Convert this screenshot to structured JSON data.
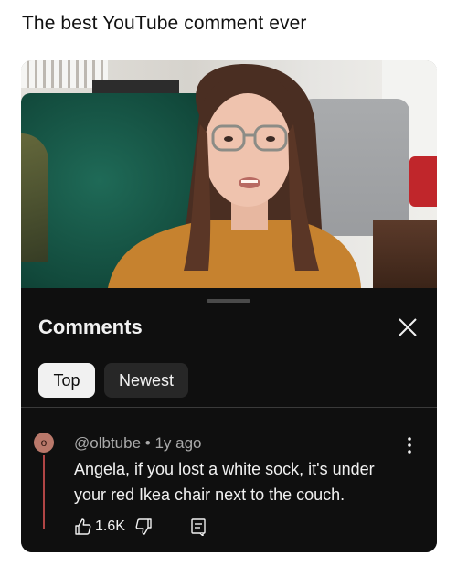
{
  "meme": {
    "title": "The best YouTube comment ever"
  },
  "panel": {
    "heading": "Comments",
    "chips": [
      {
        "label": "Top",
        "selected": true
      },
      {
        "label": "Newest",
        "selected": false
      }
    ]
  },
  "comment": {
    "avatar_letter": "o",
    "author": "@olbtube",
    "separator": "•",
    "time": "1y ago",
    "meta": "@olbtube • 1y ago",
    "text": "Angela, if you lost a white sock, it's under your red Ikea chair next to the couch.",
    "likes": "1.6K"
  },
  "icons": {
    "close": "close-icon",
    "more": "more-vert-icon",
    "like": "thumbs-up-icon",
    "dislike": "thumbs-down-icon",
    "reply": "reply-icon"
  },
  "colors": {
    "panel_bg": "#0f0f0f",
    "chip_selected": "#f1f1f1",
    "chip_unselected": "#272727",
    "avatar": "#b9786a",
    "thread_line": "#b04545"
  }
}
